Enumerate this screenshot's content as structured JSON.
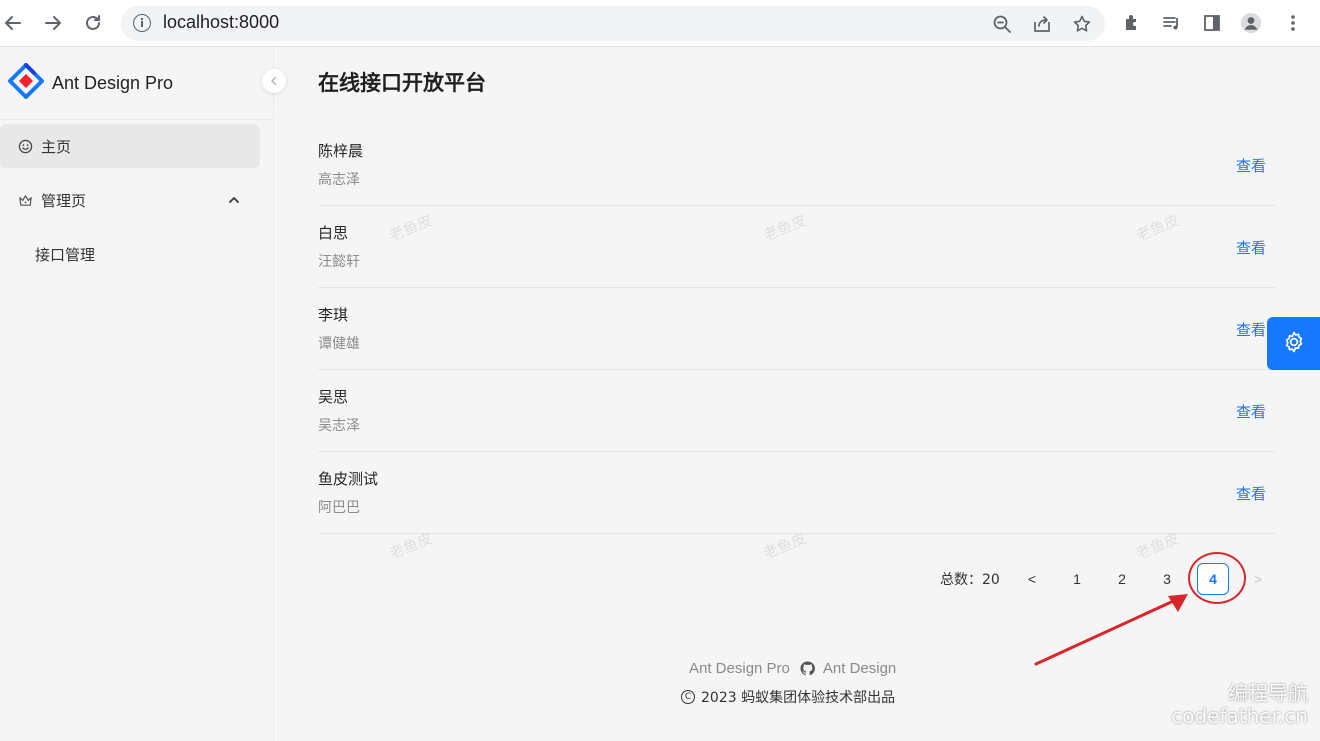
{
  "browser": {
    "url": "localhost:8000"
  },
  "sidebar": {
    "logo_text": "Ant Design Pro",
    "items": [
      {
        "label": "主页",
        "icon": "smile-icon",
        "active": true
      },
      {
        "label": "管理页",
        "icon": "crown-icon",
        "expanded": true
      },
      {
        "label": "接口管理"
      }
    ]
  },
  "main": {
    "title": "在线接口开放平台",
    "list": [
      {
        "title": "陈梓晨",
        "description": "高志泽",
        "action": "查看"
      },
      {
        "title": "白思",
        "description": "汪懿轩",
        "action": "查看"
      },
      {
        "title": "李琪",
        "description": "谭健雄",
        "action": "查看"
      },
      {
        "title": "吴思",
        "description": "吴志泽",
        "action": "查看"
      },
      {
        "title": "鱼皮测试",
        "description": "阿巴巴",
        "action": "查看"
      }
    ],
    "watermark_text": "老鱼皮",
    "pagination": {
      "total_label": "总数：20",
      "prev": "<",
      "pages": [
        "1",
        "2",
        "3",
        "4"
      ],
      "current": "4",
      "next": ">"
    }
  },
  "footer": {
    "link1": "Ant Design Pro",
    "link2": "Ant Design",
    "copyright": "2023 蚂蚁集团体验技术部出品"
  },
  "overlay": {
    "brand_line1": "编程导航",
    "brand_line2": "codefather.cn"
  },
  "colors": {
    "primary": "#1677ff",
    "annotation": "#d9262c"
  }
}
